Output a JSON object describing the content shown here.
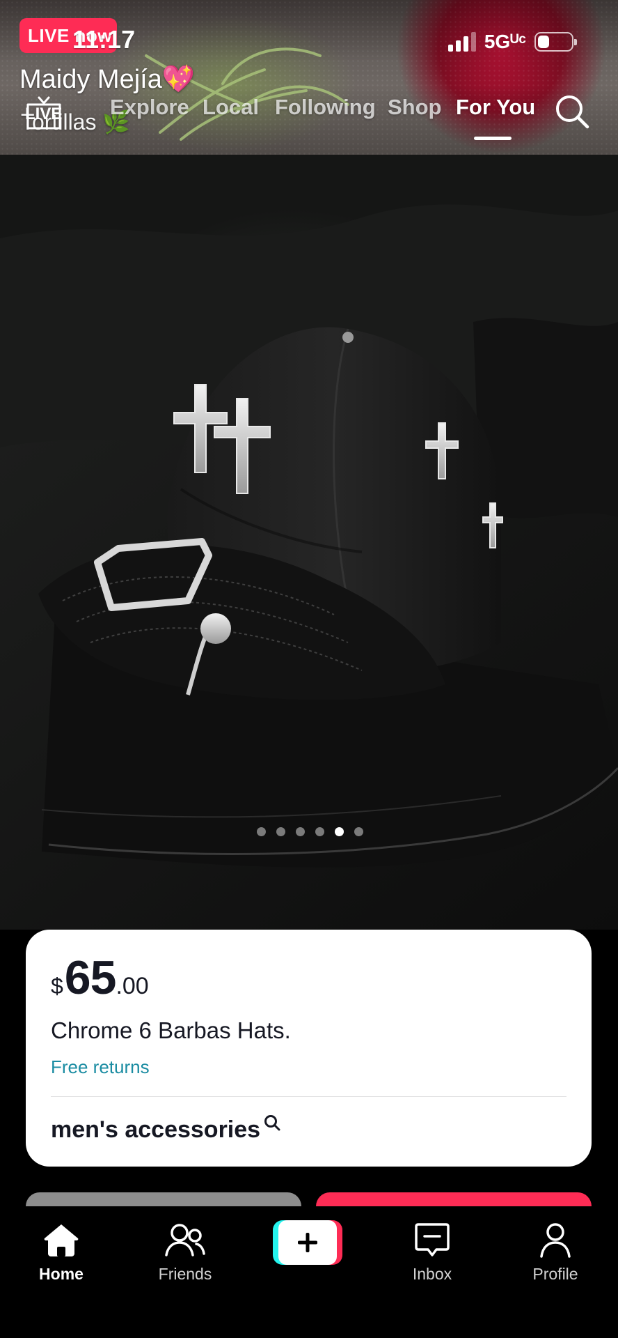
{
  "status_bar": {
    "time": "11:17",
    "network": "5Gᵁᶜ",
    "live_badge": "LIVE now"
  },
  "live_preview": {
    "streamer_name": "Maidy Mejía💖",
    "stream_title": "Tortillas 🌿"
  },
  "top_nav": {
    "live_label": "LIVE",
    "tabs": [
      {
        "label": "Explore"
      },
      {
        "label": "Local"
      },
      {
        "label": "Following"
      },
      {
        "label": "Shop"
      },
      {
        "label": "For You"
      }
    ],
    "active_tab": "For You"
  },
  "carousel": {
    "total": 6,
    "active_index": 4
  },
  "product": {
    "currency": "$",
    "price_main": "65",
    "price_cents": ".00",
    "title": "Chrome 6 Barbas Hats.",
    "badge": "Free returns",
    "category": "men's accessories"
  },
  "bottom_nav": {
    "items": [
      {
        "label": "Home",
        "icon": "home-icon"
      },
      {
        "label": "Friends",
        "icon": "friends-icon"
      },
      {
        "label": "",
        "icon": "plus-icon"
      },
      {
        "label": "Inbox",
        "icon": "inbox-icon"
      },
      {
        "label": "Profile",
        "icon": "profile-icon"
      }
    ],
    "active": "Home"
  },
  "colors": {
    "accent": "#fe2c55",
    "cyan": "#25f4ee",
    "link": "#1a8ca2"
  }
}
